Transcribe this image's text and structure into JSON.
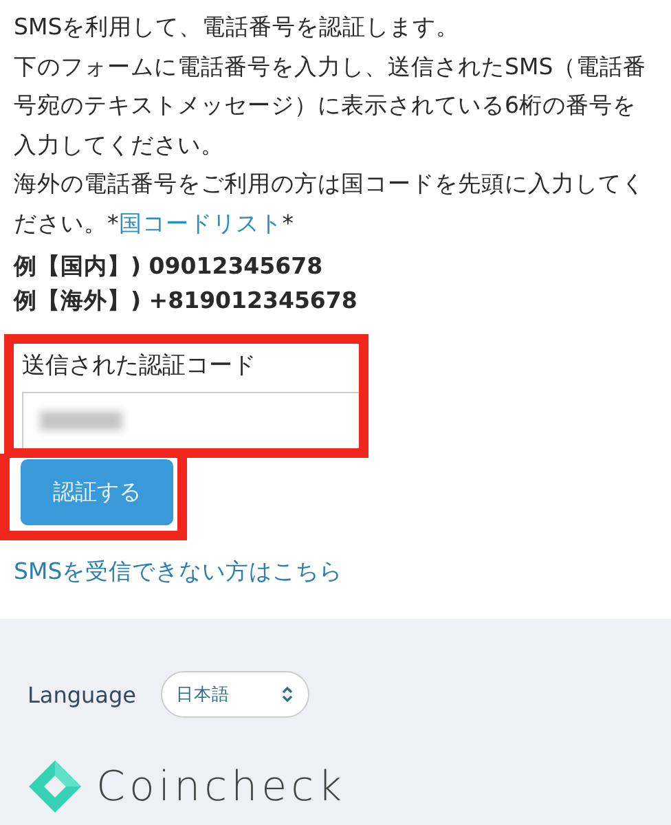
{
  "intro": [
    "SMSを利用して、電話番号を認証します。",
    "下のフォームに電話番号を入力し、送信されたSMS（電話番号宛のテキストメッセージ）に表示されている6桁の番号を入力してください。"
  ],
  "note": {
    "before": "海外の電話番号をご利用の方は国コードを先頭に入力してください。*",
    "link": "国コードリスト",
    "after": "*"
  },
  "examples": [
    "例【国内】) 09012345678",
    "例【海外】) +819012345678"
  ],
  "code_field": {
    "label": "送信された認証コード",
    "redacted": true
  },
  "submit_button": "認証する",
  "help_link": "SMSを受信できない方はこちら",
  "footer": {
    "language_label": "Language",
    "language_value": "日本語",
    "brand": "Coincheck"
  }
}
